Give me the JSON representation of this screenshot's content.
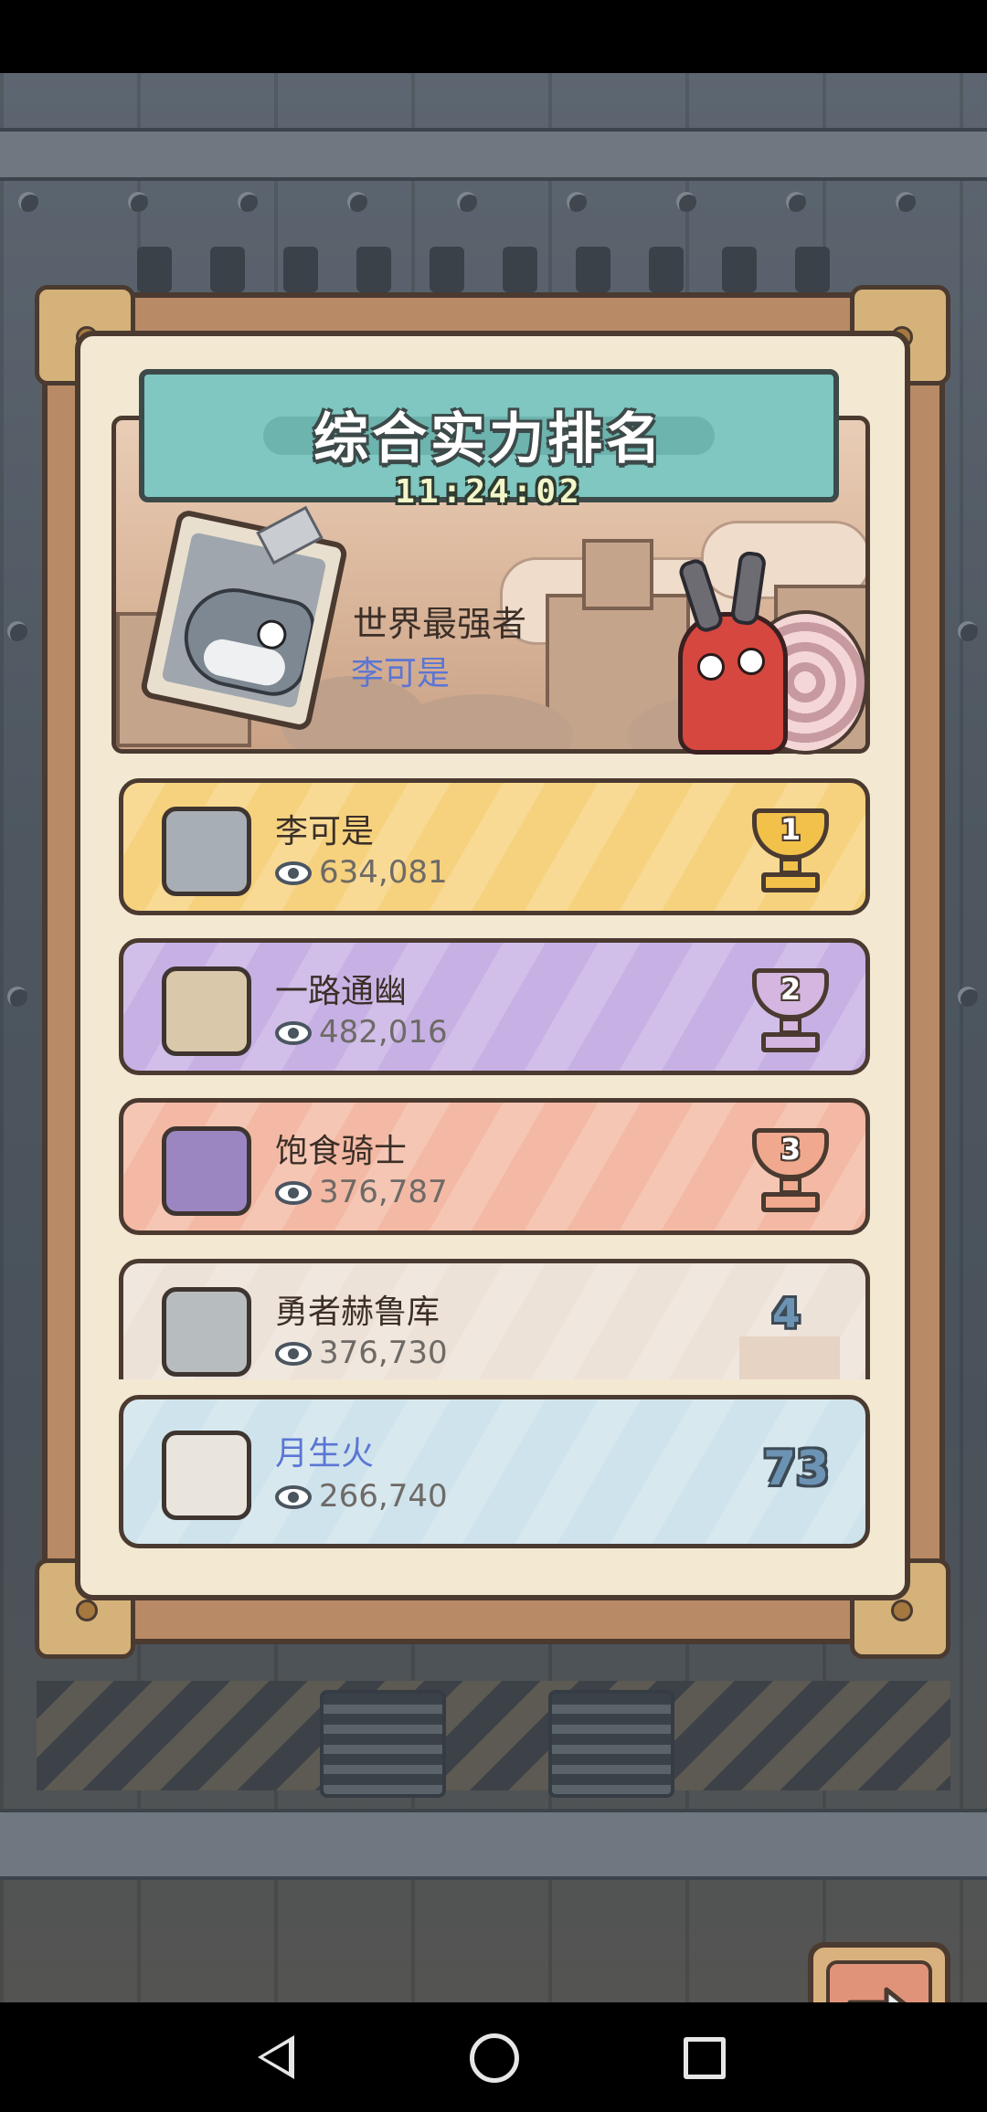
{
  "header": {
    "title": "综合实力排名",
    "timer": "11:24:02"
  },
  "champion": {
    "label": "世界最强者",
    "name": "李可是"
  },
  "rankings": [
    {
      "name": "李可是",
      "score": "634,081",
      "rank": "1",
      "style": "gold"
    },
    {
      "name": "一路通幽",
      "score": "482,016",
      "rank": "2",
      "style": "purple"
    },
    {
      "name": "饱食骑士",
      "score": "376,787",
      "rank": "3",
      "style": "bronze"
    },
    {
      "name": "勇者赫鲁库",
      "score": "376,730",
      "rank": "4",
      "style": "plain"
    }
  ],
  "self": {
    "name": "月生火",
    "score": "266,740",
    "rank": "73"
  },
  "colors": {
    "gold_row": "#f6d27e",
    "purple_row": "#c7b1e4",
    "bronze_row": "#f3b9a4",
    "plain_row": "#ede2d8",
    "self_row": "#cfe3ec",
    "self_name": "#5b76d4"
  },
  "icons": {
    "views": "eye-icon",
    "next": "arrow-right-icon",
    "nav_back": "triangle-back-icon",
    "nav_home": "circle-home-icon",
    "nav_recent": "square-recent-icon"
  }
}
